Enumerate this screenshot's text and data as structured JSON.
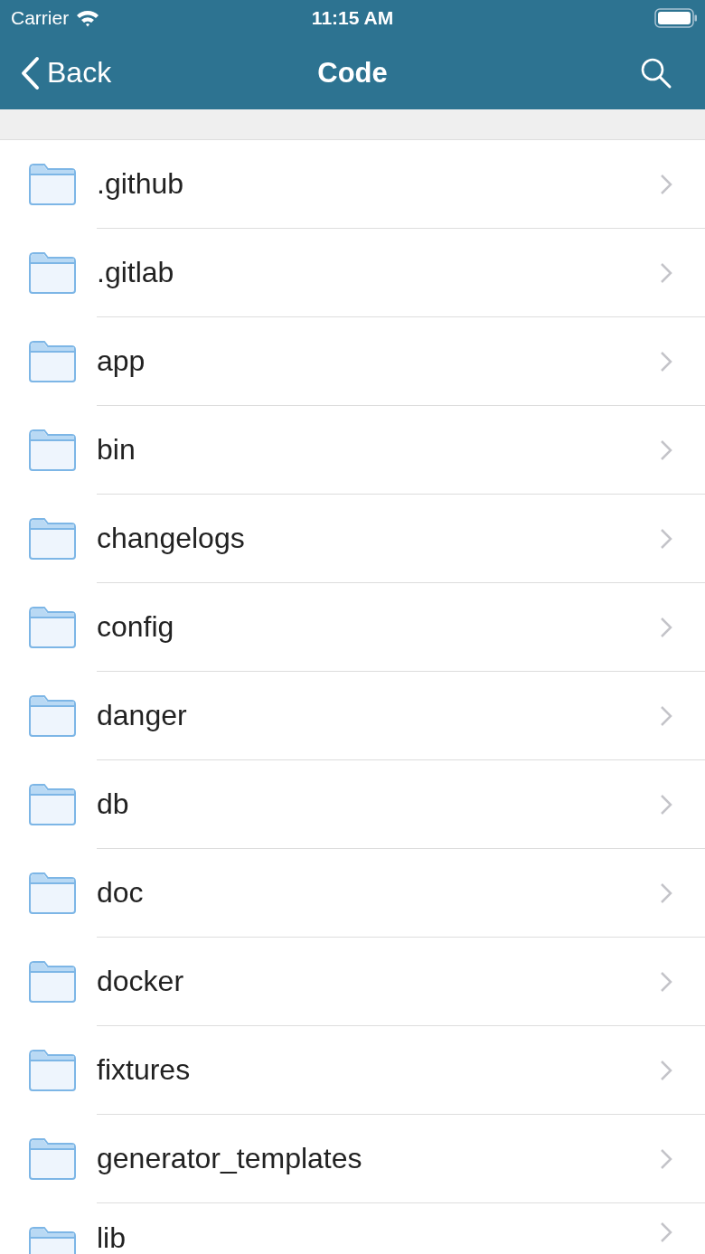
{
  "status_bar": {
    "carrier": "Carrier",
    "time": "11:15 AM"
  },
  "nav": {
    "back": "Back",
    "title": "Code"
  },
  "folders": [
    {
      "name": ".github"
    },
    {
      "name": ".gitlab"
    },
    {
      "name": "app"
    },
    {
      "name": "bin"
    },
    {
      "name": "changelogs"
    },
    {
      "name": "config"
    },
    {
      "name": "danger"
    },
    {
      "name": "db"
    },
    {
      "name": "doc"
    },
    {
      "name": "docker"
    },
    {
      "name": "fixtures"
    },
    {
      "name": "generator_templates"
    },
    {
      "name": "lib"
    }
  ]
}
